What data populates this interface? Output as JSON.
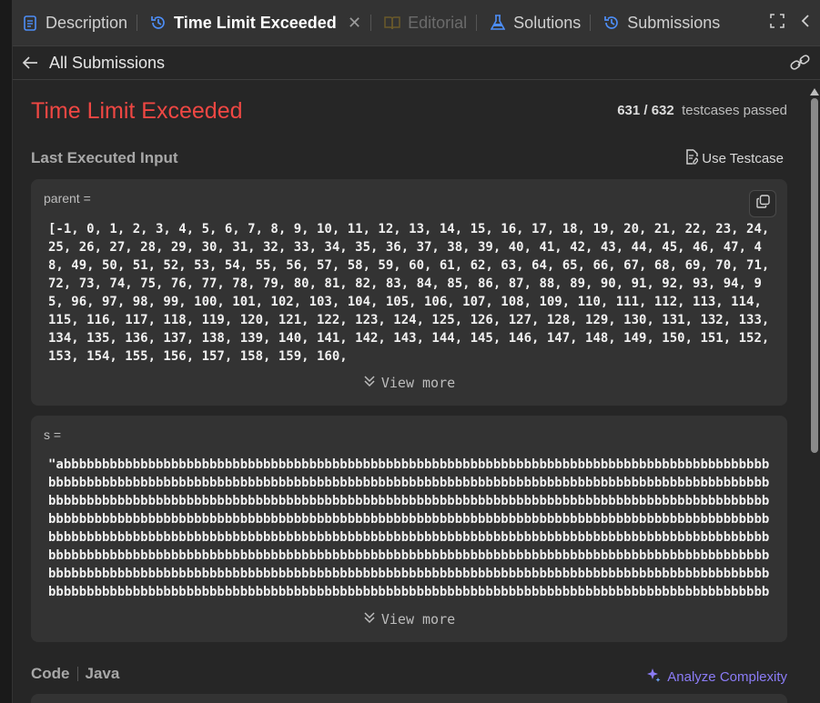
{
  "tabs": [
    {
      "label": "Description",
      "icon": "description-icon",
      "state": "normal"
    },
    {
      "label": "Time Limit Exceeded",
      "icon": "history-icon",
      "state": "active"
    },
    {
      "label": "Editorial",
      "icon": "book-icon",
      "state": "disabled"
    },
    {
      "label": "Solutions",
      "icon": "flask-icon",
      "state": "normal"
    },
    {
      "label": "Submissions",
      "icon": "history-icon",
      "state": "normal"
    }
  ],
  "subheader": {
    "back_label": "All Submissions"
  },
  "result": {
    "status": "Time Limit Exceeded",
    "passed": "631 / 632",
    "passed_suffix": "testcases passed",
    "status_color": "#ef4743"
  },
  "last_input": {
    "heading": "Last Executed Input",
    "use_testcase": "Use Testcase",
    "params": [
      {
        "name": "parent =",
        "value": "[-1, 0, 1, 2, 3, 4, 5, 6, 7, 8, 9, 10, 11, 12, 13, 14, 15, 16, 17, 18, 19, 20, 21, 22, 23, 24, 25, 26, 27, 28, 29, 30, 31, 32, 33, 34, 35, 36, 37, 38, 39, 40, 41, 42, 43, 44, 45, 46, 47, 48, 49, 50, 51, 52, 53, 54, 55, 56, 57, 58, 59, 60, 61, 62, 63, 64, 65, 66, 67, 68, 69, 70, 71, 72, 73, 74, 75, 76, 77, 78, 79, 80, 81, 82, 83, 84, 85, 86, 87, 88, 89, 90, 91, 92, 93, 94, 95, 96, 97, 98, 99, 100, 101, 102, 103, 104, 105, 106, 107, 108, 109, 110, 111, 112, 113, 114, 115, 116, 117, 118, 119, 120, 121, 122, 123, 124, 125, 126, 127, 128, 129, 130, 131, 132, 133, 134, 135, 136, 137, 138, 139, 140, 141, 142, 143, 144, 145, 146, 147, 148, 149, 150, 151, 152, 153, 154, 155, 156, 157, 158, 159, 160,",
        "view_more": "View more"
      },
      {
        "name": "s =",
        "value": "\"abbbbbbbbbbbbbbbbbbbbbbbbbbbbbbbbbbbbbbbbbbbbbbbbbbbbbbbbbbbbbbbbbbbbbbbbbbbbbbbbbbbbbbbbbbbbbbbbbbbbbbbbbbbbbbbbbbbbbbbbbbbbbbbbbbbbbbbbbbbbbbbbbbbbbbbbbbbbbbbbbbbbbbbbbbbbbbbbbbbbbbbbbbbbbbbbbbbbbbbbbbbbbbbbbbbbbbbbbbbbbbbbbbbbbbbbbbbbbbbbbbbbbbbbbbbbbbbbbbbbbbbbbbbbbbbbbbbbbbbbbbbbbbbbbbbbbbbbbbbbbbbbbbbbbbbbbbbbbbbbbbbbbbbbbbbbbbbbbbbbbbbbbbbbbbbbbbbbbbbbbbbbbbbbbbbbbbbbbbbbbbbbbbbbbbbbbbbbbbbbbbbbbbbbbbbbbbbbbbbbbbbbbbbbbbbbbbbbbbbbbbbbbbbbbbbbbbbbbbbbbbbbbbbbbbbbbbbbbbbbbbbbbbbbbbbbbbbbbbbbbbbbbbbbbbbbbbbbbbbbbbbbbbbbbbbbbbbbbbbbbbbbbbbbbbbbbbbbbbbbbbbbbbbbbbbbbbbbbbbbbbbbbbbbbbbbbbbbbbbbbbbbbbbbbbbbbbbbbbbbbbbbbbbbbbbbbbbbbbbbbbbbbbbbbbbbbbbbbbbbbbbbbbbbbbbbbbbbbbbbbbbbbbbbbbbbbbbbbbbbbbbbbbbbbbbbbbbbbbbbbbbbbbbbbbbbbbbbbbbbbbbbbbbbbbbbbbbbbbbbbbbbbbbbbbbbbbbbbbbbbbbbbbbbbbbbbbbbbbbbbb",
        "view_more": "View more"
      }
    ]
  },
  "code": {
    "label": "Code",
    "language": "Java",
    "analyze": "Analyze Complexity",
    "analyze_color": "#8b7cf6"
  }
}
